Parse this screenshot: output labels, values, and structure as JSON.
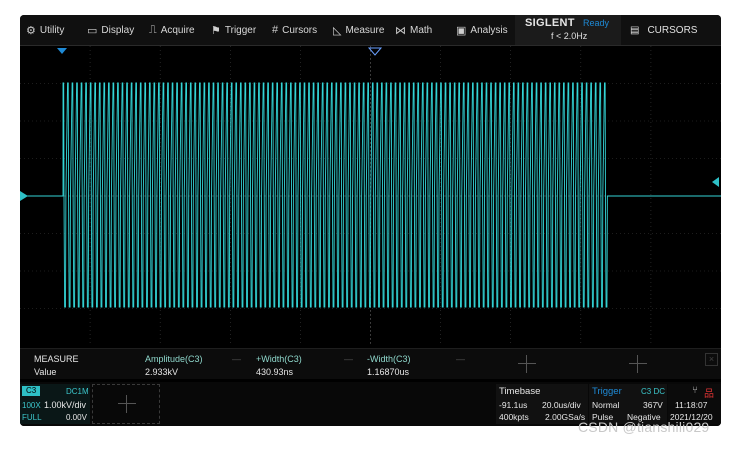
{
  "menu": [
    {
      "label": "Utility",
      "icon": "gear-icon",
      "glyph": "⚙"
    },
    {
      "label": "Display",
      "icon": "monitor-icon",
      "glyph": "▭"
    },
    {
      "label": "Acquire",
      "icon": "acquire-icon",
      "glyph": "⎍"
    },
    {
      "label": "Trigger",
      "icon": "trigger-flag-icon",
      "glyph": "⚑"
    },
    {
      "label": "Cursors",
      "icon": "cursors-grid-icon",
      "glyph": "#"
    },
    {
      "label": "Measure",
      "icon": "measure-icon",
      "glyph": "◺"
    },
    {
      "label": "Math",
      "icon": "math-icon",
      "glyph": "⋈"
    },
    {
      "label": "Analysis",
      "icon": "analysis-icon",
      "glyph": "▣"
    }
  ],
  "brand": {
    "name": "SIGLENT",
    "status": "Ready",
    "freq": "f < 2.0Hz"
  },
  "cursors_tab": {
    "label": "CURSORS",
    "icon": "document-icon",
    "glyph": "▤"
  },
  "measure": {
    "title": "MEASURE",
    "row_label": "Value",
    "headers": [
      "Amplitude(C3)",
      "+Width(C3)",
      "-Width(C3)"
    ],
    "values": [
      "2.933kV",
      "430.93ns",
      "1.16870us"
    ]
  },
  "channel": {
    "name": "C3",
    "coupling": "DC1M",
    "probe": "100X",
    "scale": "1.00kV/div",
    "bandwidth": "FULL",
    "offset": "0.00V"
  },
  "timebase": {
    "label": "Timebase",
    "delay": "-91.1us",
    "scale": "20.0us/div",
    "points": "400kpts",
    "sample_rate": "2.00GSa/s"
  },
  "trigger": {
    "label": "Trigger",
    "source": "C3 DC",
    "mode": "Normal",
    "level": "367V",
    "type": "Pulse",
    "slope": "Negative"
  },
  "system": {
    "time": "11:18:07",
    "date": "2021/12/20"
  },
  "watermark": "CSDN @tianshili029",
  "colors": {
    "trace": "#33d4d6",
    "grid": "#3a3a3a",
    "accent": "#1e8ad6",
    "channel": "#2ec0c6",
    "measure_header": "#8fd8cc"
  }
}
